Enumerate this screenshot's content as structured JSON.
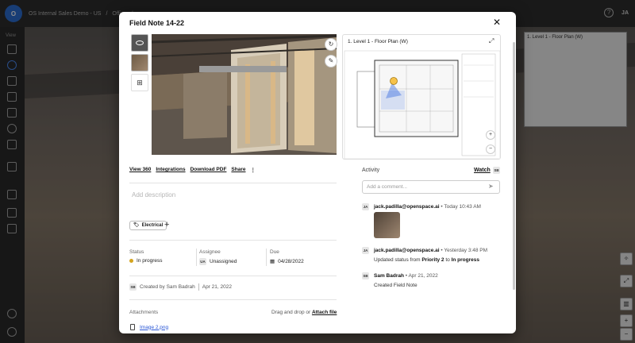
{
  "app": {
    "breadcrumb": [
      "OS Internal Sales Demo - US",
      "/",
      "Office",
      "/"
    ],
    "user_initials": "JA",
    "sidebar_label": "View",
    "minimap_title": "1. Level 1 - Floor Plan (W)"
  },
  "modal": {
    "title": "Field Note 14-22",
    "close_icon": "close-icon",
    "links": [
      "View 360",
      "Integrations",
      "Download PDF",
      "Share"
    ],
    "more_label": "⋮",
    "description_placeholder": "Add description",
    "tag": "Electrical",
    "add_tag": "+",
    "fields": {
      "status_label": "Status",
      "status_value": "In progress",
      "assignee_label": "Assignee",
      "assignee_initials": "UA",
      "assignee_value": "Unassigned",
      "due_label": "Due",
      "due_value": "04/28/2022"
    },
    "created": {
      "initials": "SB",
      "by": "Created by Sam Badrah",
      "date": "Apr 21, 2022"
    },
    "attachments": {
      "label": "Attachments",
      "hint": "Drag and drop or",
      "action": "Attach file",
      "file": "Image 2.png"
    },
    "floorplan": {
      "title": "1. Level 1 - Floor Plan (W)"
    },
    "activity": {
      "label": "Activity",
      "watch": "Watch",
      "watch_initials": "SB",
      "comment_placeholder": "Add a comment...",
      "entries": [
        {
          "initials": "JA",
          "user": "jack.padilla@openspace.ai",
          "time": "• Today 10:43 AM"
        },
        {
          "initials": "JA",
          "user": "jack.padilla@openspace.ai",
          "time": "• Yesterday 3:48 PM",
          "text_a": "Updated status from",
          "from": "Priority 2",
          "text_b": "to",
          "to": "In progress"
        },
        {
          "initials": "SB",
          "user": "Sam Badrah",
          "time": "• Apr 21, 2022",
          "text": "Created Field Note"
        }
      ]
    }
  },
  "colors": {
    "accent": "#2a57d6",
    "status_dot": "#d4a41e",
    "floorplan_room": "#3b6fe0"
  }
}
